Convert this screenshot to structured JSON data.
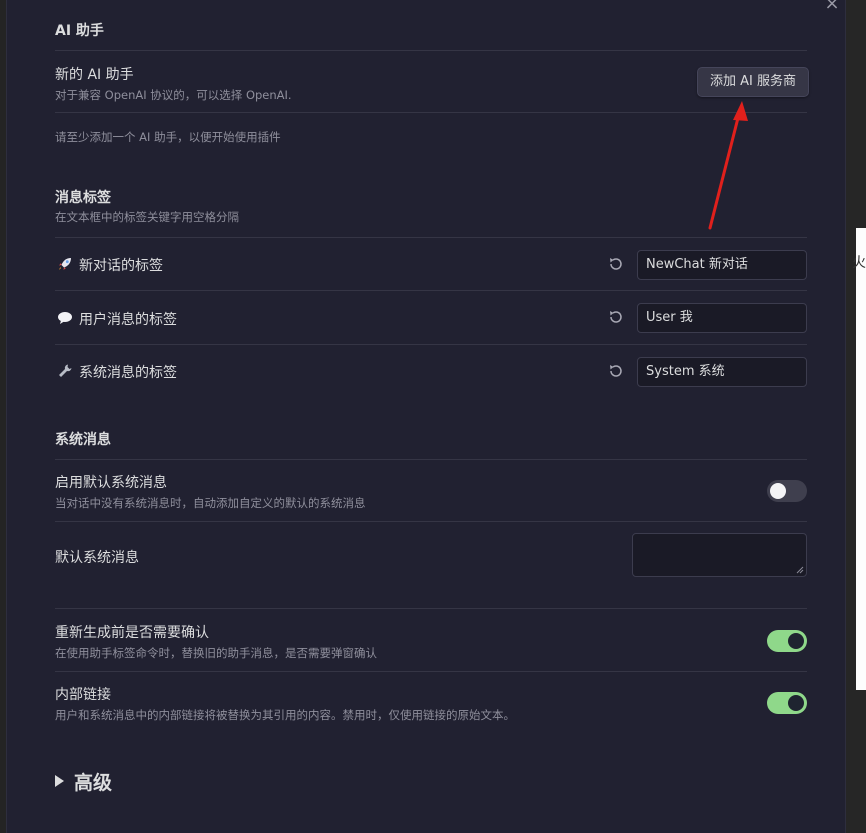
{
  "close_label": "×",
  "background": {
    "peek_char": "火"
  },
  "ai_section": {
    "heading": "AI 助手",
    "new_assistant": {
      "name": "新的 AI 助手",
      "desc": "对于兼容 OpenAI 协议的，可以选择 OpenAI.",
      "button": "添加 AI 服务商"
    },
    "hint": "请至少添加一个 AI 助手，以便开始使用插件"
  },
  "tags_section": {
    "heading": "消息标签",
    "desc": "在文本框中的标签关键字用空格分隔",
    "items": [
      {
        "icon": "rocket-icon",
        "label": "新对话的标签",
        "value": "NewChat 新对话"
      },
      {
        "icon": "speech-bubble-icon",
        "label": "用户消息的标签",
        "value": "User 我"
      },
      {
        "icon": "wrench-icon",
        "label": "系统消息的标签",
        "value": "System 系统"
      }
    ]
  },
  "system_section": {
    "heading": "系统消息",
    "enable_default": {
      "name": "启用默认系统消息",
      "desc": "当对话中没有系统消息时，自动添加自定义的默认的系统消息",
      "enabled": false
    },
    "default_message": {
      "name": "默认系统消息",
      "value": ""
    },
    "confirm_regen": {
      "name": "重新生成前是否需要确认",
      "desc": "在使用助手标签命令时，替换旧的助手消息，是否需要弹窗确认",
      "enabled": true
    },
    "internal_links": {
      "name": "内部链接",
      "desc": "用户和系统消息中的内部链接将被替换为其引用的内容。禁用时，仅使用链接的原始文本。",
      "enabled": true
    }
  },
  "advanced": {
    "label": "高级"
  },
  "colors": {
    "modal_bg": "#212131",
    "toggle_on": "#8fd88a",
    "toggle_off": "#3f3f4e",
    "annotation_arrow": "#e0201c"
  }
}
